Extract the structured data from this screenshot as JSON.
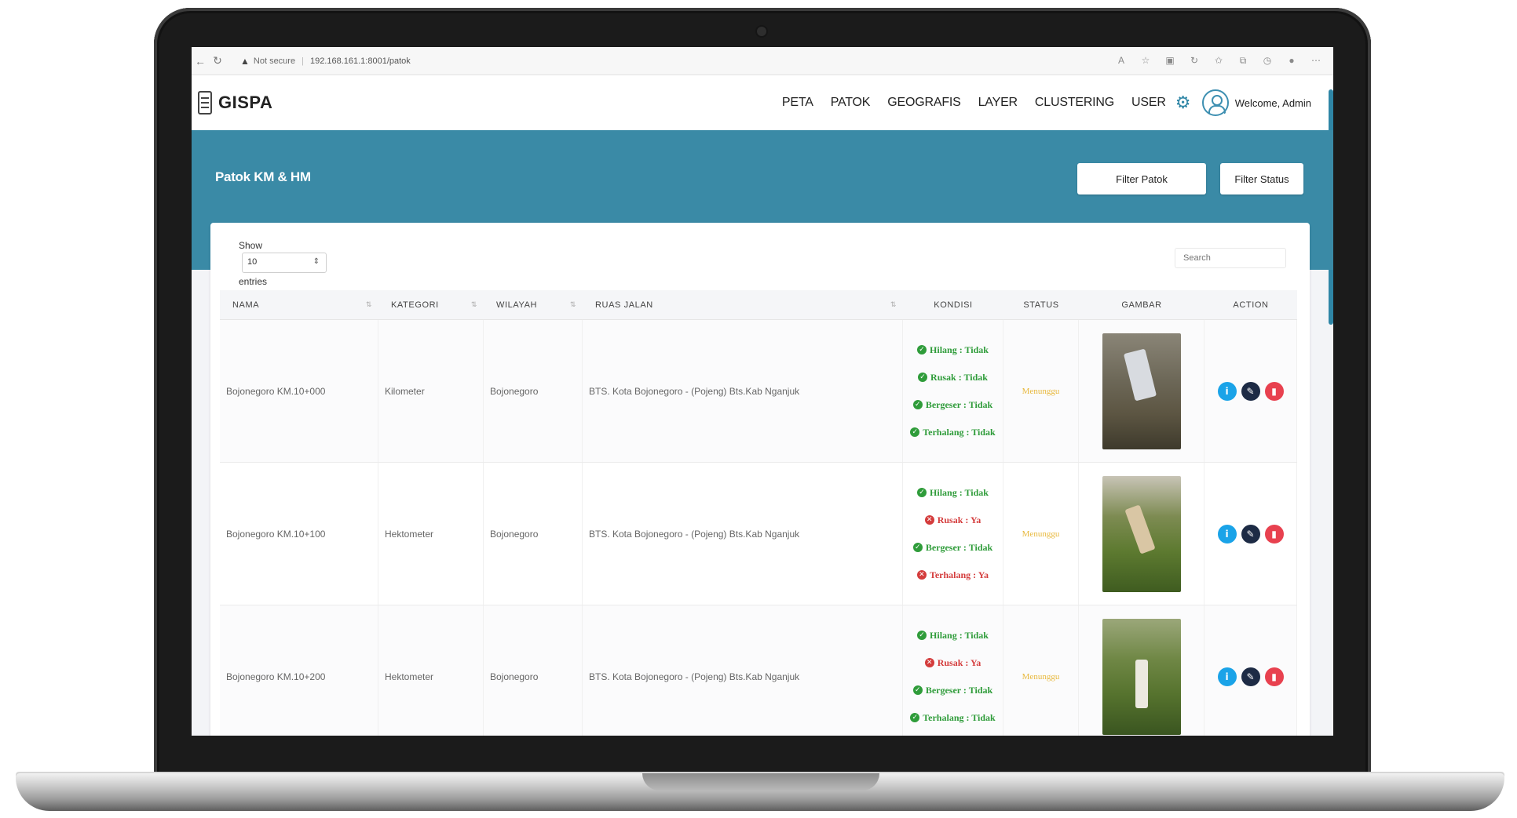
{
  "browser": {
    "security_label": "Not secure",
    "url": "192.168.161.1:8001/patok"
  },
  "nav": {
    "brand": "GISPA",
    "items": [
      "PETA",
      "PATOK",
      "GEOGRAFIS",
      "LAYER",
      "CLUSTERING",
      "USER"
    ],
    "welcome": "Welcome, Admin"
  },
  "banner": {
    "title": "Patok KM & HM",
    "filter_patok": "Filter Patok",
    "filter_status": "Filter Status"
  },
  "table_controls": {
    "show_label": "Show",
    "page_length": "10",
    "entries_label": "entries",
    "search_placeholder": "Search"
  },
  "table": {
    "columns": [
      "NAMA",
      "KATEGORI",
      "WILAYAH",
      "RUAS JALAN",
      "KONDISI",
      "STATUS",
      "GAMBAR",
      "ACTION"
    ],
    "rows": [
      {
        "nama": "Bojonegoro KM.10+000",
        "kategori": "Kilometer",
        "wilayah": "Bojonegoro",
        "ruas_jalan": "BTS. Kota Bojonegoro - (Pojeng) Bts.Kab Nganjuk",
        "kondisi": [
          {
            "text": "Hilang : Tidak",
            "state": "ok"
          },
          {
            "text": "Rusak : Tidak",
            "state": "ok"
          },
          {
            "text": "Bergeser : Tidak",
            "state": "ok"
          },
          {
            "text": "Terhalang : Tidak",
            "state": "ok"
          }
        ],
        "status": "Menunggu"
      },
      {
        "nama": "Bojonegoro KM.10+100",
        "kategori": "Hektometer",
        "wilayah": "Bojonegoro",
        "ruas_jalan": "BTS. Kota Bojonegoro - (Pojeng) Bts.Kab Nganjuk",
        "kondisi": [
          {
            "text": "Hilang : Tidak",
            "state": "ok"
          },
          {
            "text": "Rusak : Ya",
            "state": "bad"
          },
          {
            "text": "Bergeser : Tidak",
            "state": "ok"
          },
          {
            "text": "Terhalang : Ya",
            "state": "bad"
          }
        ],
        "status": "Menunggu"
      },
      {
        "nama": "Bojonegoro KM.10+200",
        "kategori": "Hektometer",
        "wilayah": "Bojonegoro",
        "ruas_jalan": "BTS. Kota Bojonegoro - (Pojeng) Bts.Kab Nganjuk",
        "kondisi": [
          {
            "text": "Hilang : Tidak",
            "state": "ok"
          },
          {
            "text": "Rusak : Ya",
            "state": "bad"
          },
          {
            "text": "Bergeser : Tidak",
            "state": "ok"
          },
          {
            "text": "Terhalang : Tidak",
            "state": "ok"
          }
        ],
        "status": "Menunggu"
      }
    ]
  },
  "icons": {
    "status_ok": "check-circle-icon",
    "status_bad": "x-circle-icon",
    "action_info": "info-icon",
    "action_edit": "edit-icon",
    "action_delete": "trash-icon"
  },
  "colors": {
    "primary": "#3a8aa6",
    "ok": "#2f9c3a",
    "bad": "#d43c3c",
    "status_pending": "#e8b83c",
    "info": "#1aa3e8",
    "edit": "#1d2b45",
    "delete": "#e8414f"
  }
}
